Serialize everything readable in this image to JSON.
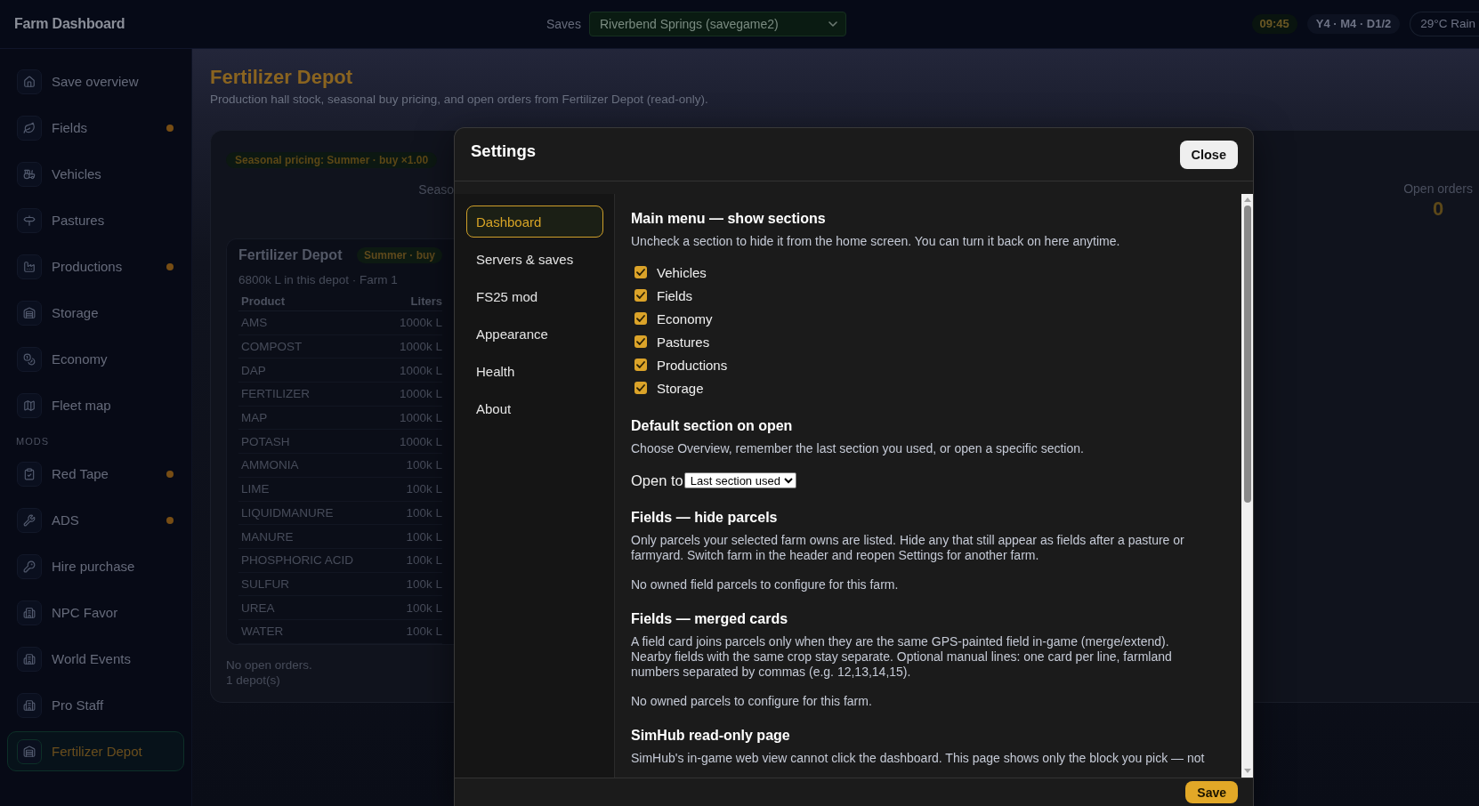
{
  "topbar": {
    "title": "Farm Dashboard",
    "saves_label": "Saves",
    "save_select": "Riverbend Springs (savegame2)",
    "time": "09:45",
    "date": "Y4 · M4 · D1/2",
    "weather": "29°C Rain"
  },
  "sidebar": {
    "items": [
      {
        "label": "Save overview",
        "selected": false,
        "alert": false
      },
      {
        "label": "Fields",
        "selected": false,
        "alert": true
      },
      {
        "label": "Vehicles",
        "selected": false,
        "alert": false
      },
      {
        "label": "Pastures",
        "selected": false,
        "alert": false
      },
      {
        "label": "Productions",
        "selected": false,
        "alert": true
      },
      {
        "label": "Storage",
        "selected": false,
        "alert": false
      },
      {
        "label": "Economy",
        "selected": false,
        "alert": false
      },
      {
        "label": "Fleet map",
        "selected": false,
        "alert": false
      }
    ],
    "mods_heading": "MODS",
    "mod_items": [
      {
        "label": "Red Tape",
        "selected": false,
        "alert": true
      },
      {
        "label": "ADS",
        "selected": false,
        "alert": true
      },
      {
        "label": "Hire purchase",
        "selected": false,
        "alert": false
      },
      {
        "label": "NPC Favor",
        "selected": false,
        "alert": false
      },
      {
        "label": "World Events",
        "selected": false,
        "alert": false
      },
      {
        "label": "Pro Staff",
        "selected": false,
        "alert": false
      },
      {
        "label": "Fertilizer Depot",
        "selected": true,
        "alert": false
      }
    ]
  },
  "page": {
    "title": "Fertilizer Depot",
    "subtitle": "Production hall stock, seasonal buy pricing, and open orders from Fertilizer Depot (read-only).",
    "pricing_badge": "Seasonal pricing: Summer · buy ×1.00",
    "partial_label": "Seaso",
    "depot_card": {
      "title": "Fertilizer Depot",
      "badge": "Summer · buy",
      "summary": "6800k L in this depot · Farm 1",
      "columns": [
        "Product",
        "Liters"
      ],
      "rows": [
        [
          "AMS",
          "1000k L"
        ],
        [
          "COMPOST",
          "1000k L"
        ],
        [
          "DAP",
          "1000k L"
        ],
        [
          "FERTILIZER",
          "1000k L"
        ],
        [
          "MAP",
          "1000k L"
        ],
        [
          "POTASH",
          "1000k L"
        ],
        [
          "AMMONIA",
          "100k L"
        ],
        [
          "LIME",
          "100k L"
        ],
        [
          "LIQUIDMANURE",
          "100k L"
        ],
        [
          "MANURE",
          "100k L"
        ],
        [
          "PHOSPHORIC ACID",
          "100k L"
        ],
        [
          "SULFUR",
          "100k L"
        ],
        [
          "UREA",
          "100k L"
        ],
        [
          "WATER",
          "100k L"
        ]
      ]
    },
    "orders_note": "No open orders.",
    "depot_count": "1 depot(s)",
    "open_orders": {
      "label": "Open orders",
      "value": "0"
    }
  },
  "settings_dialog": {
    "title": "Settings",
    "close_button": "Close",
    "nav": [
      {
        "label": "Dashboard",
        "selected": true
      },
      {
        "label": "Servers & saves",
        "selected": false
      },
      {
        "label": "FS25 mod",
        "selected": false
      },
      {
        "label": "Appearance",
        "selected": false
      },
      {
        "label": "Health",
        "selected": false
      },
      {
        "label": "About",
        "selected": false
      }
    ],
    "sections": [
      {
        "heading": "Main menu — show sections",
        "paragraphs": [
          "Uncheck a section to hide it from the home screen. You can turn it back on here anytime."
        ],
        "checkboxes": [
          {
            "label": "Vehicles",
            "checked": true
          },
          {
            "label": "Fields",
            "checked": true
          },
          {
            "label": "Economy",
            "checked": true
          },
          {
            "label": "Pastures",
            "checked": true
          },
          {
            "label": "Productions",
            "checked": true
          },
          {
            "label": "Storage",
            "checked": true
          }
        ]
      },
      {
        "heading": "Default section on open",
        "paragraphs": [
          "Choose Overview, remember the last section you used, or open a specific section."
        ],
        "select": {
          "label": "Open to",
          "value": "Last section used"
        }
      },
      {
        "heading": "Fields — hide parcels",
        "paragraphs": [
          "Only parcels your selected farm owns are listed. Hide any that still appear as fields after a pasture or farmyard. Switch farm in the header and reopen Settings for another farm.",
          "No owned field parcels to configure for this farm."
        ]
      },
      {
        "heading": "Fields — merged cards",
        "paragraphs": [
          "A field card joins parcels only when they are the same GPS-painted field in-game (merge/extend). Nearby fields with the same crop stay separate. Optional manual lines: one card per line, farmland numbers separated by commas (e.g. 12,13,14,15).",
          "No owned parcels to configure for this farm."
        ]
      },
      {
        "heading": "SimHub read-only page",
        "paragraphs": [
          "SimHub's in-game web view cannot click the dashboard. This page shows only the block you pick — not"
        ]
      }
    ],
    "save_button": "Save"
  }
}
